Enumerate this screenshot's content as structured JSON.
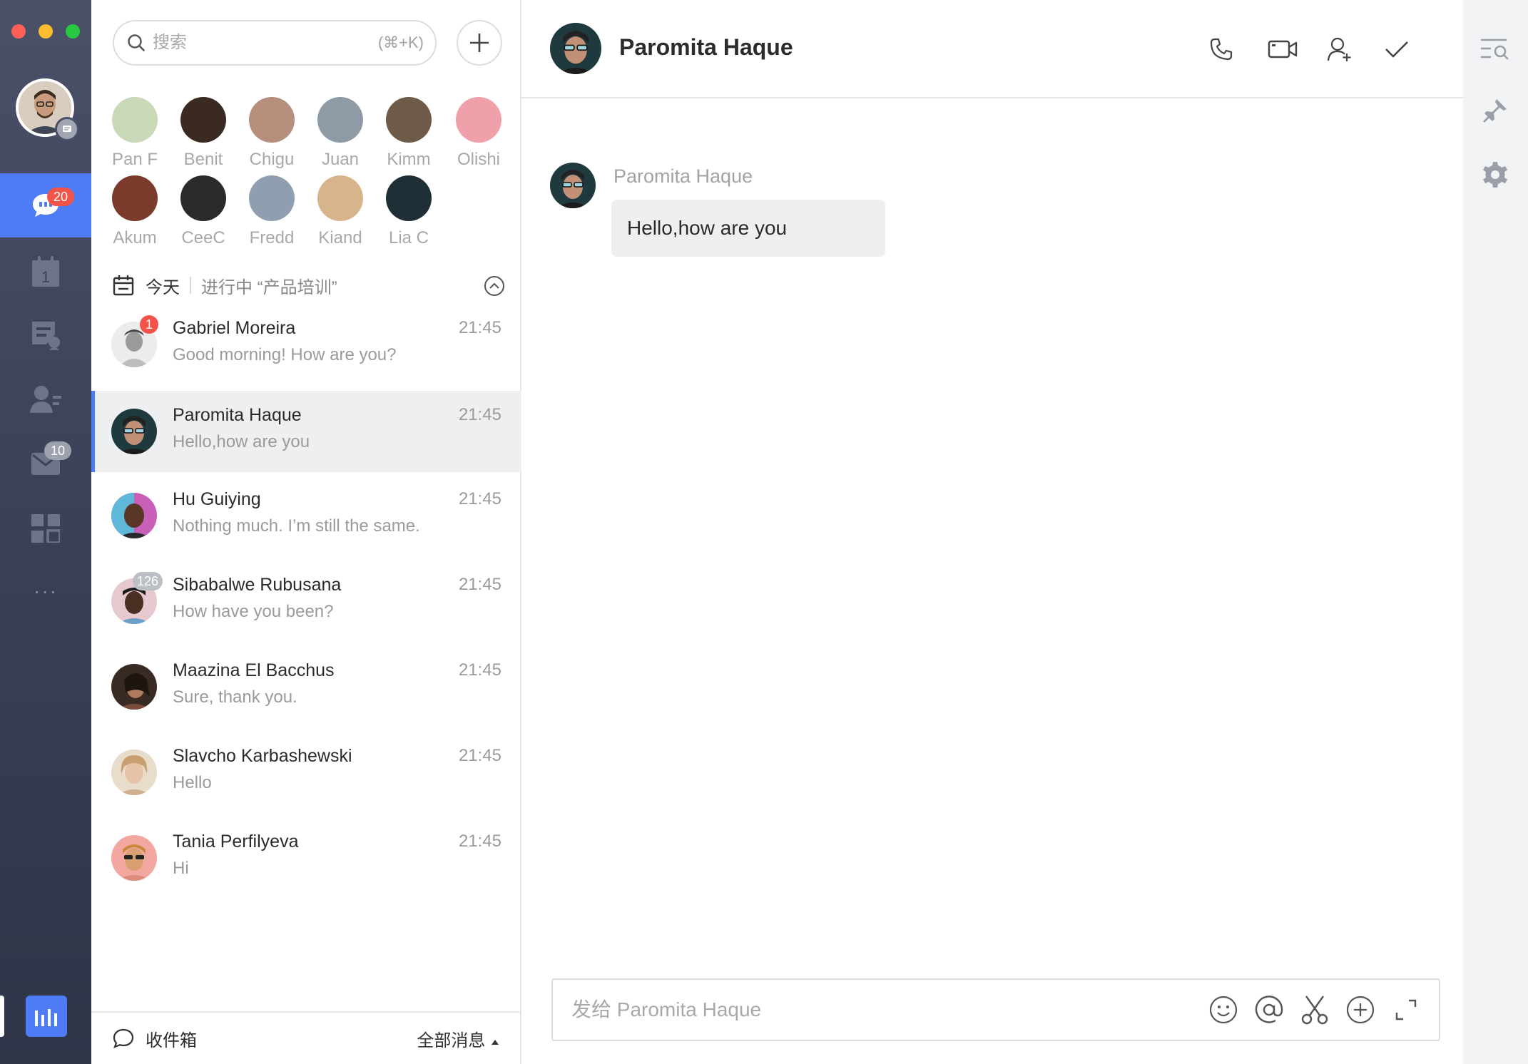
{
  "window": {
    "traffic_lights": [
      "close",
      "minimize",
      "zoom"
    ]
  },
  "nav": {
    "chat_badge": "20",
    "calendar_day": "1",
    "mail_badge": "10",
    "more": "···"
  },
  "search": {
    "placeholder": "搜索",
    "hotkey": "(⌘+K)"
  },
  "contacts": [
    {
      "name": "Pan F",
      "color": "#c9d8b6"
    },
    {
      "name": "Benit",
      "color": "#3a2a22"
    },
    {
      "name": "Chigu",
      "color": "#b58e7c"
    },
    {
      "name": "Juan",
      "color": "#8e9aa6"
    },
    {
      "name": "Kimm",
      "color": "#6e5a48"
    },
    {
      "name": "Olishi",
      "color": "#f0a0a8"
    },
    {
      "name": "Akum",
      "color": "#7a3a2c"
    },
    {
      "name": "CeeC",
      "color": "#2b2b2b"
    },
    {
      "name": "Fredd",
      "color": "#8f9fb0"
    },
    {
      "name": "Kiand",
      "color": "#d8b48c"
    },
    {
      "name": "Lia C",
      "color": "#1f2f36"
    }
  ],
  "today_bar": {
    "label": "今天",
    "event": "进行中 “产品培训”"
  },
  "conversations": [
    {
      "name": "Gabriel Moreira",
      "message": "Good morning! How are you?",
      "time": "21:45",
      "badge": "1",
      "avatar_color": "#cfcfcf"
    },
    {
      "name": "Paromita Haque",
      "message": "Hello,how are you",
      "time": "21:45",
      "badge": "",
      "avatar_color": "#1f3a3e"
    },
    {
      "name": "Hu Guiying",
      "message": "Nothing much. I’m still the same.",
      "time": "21:45",
      "badge": "",
      "avatar_color": "#c860b8"
    },
    {
      "name": "Sibabalwe Rubusana",
      "message": "How have you been?",
      "time": "21:45",
      "badge": "126",
      "avatar_color": "#e6c8cf"
    },
    {
      "name": "Maazina El Bacchus",
      "message": "Sure, thank you.",
      "time": "21:45",
      "badge": "",
      "avatar_color": "#5a3a2e"
    },
    {
      "name": "Slavcho Karbashewski",
      "message": "Hello",
      "time": "21:45",
      "badge": "",
      "avatar_color": "#d9b896"
    },
    {
      "name": "Tania Perfilyeva",
      "message": "Hi",
      "time": "21:45",
      "badge": "",
      "avatar_color": "#f2a8a0"
    }
  ],
  "list_footer": {
    "inbox": "收件箱",
    "filter": "全部消息"
  },
  "chat": {
    "title": "Paromita Haque",
    "messages": [
      {
        "sender": "Paromita Haque",
        "text": "Hello,how are you"
      }
    ],
    "composer_placeholder": "发给 Paromita Haque"
  },
  "colors": {
    "accent": "#4d7cf6",
    "badge_red": "#f25449",
    "rail_dark": "#3c4258"
  }
}
